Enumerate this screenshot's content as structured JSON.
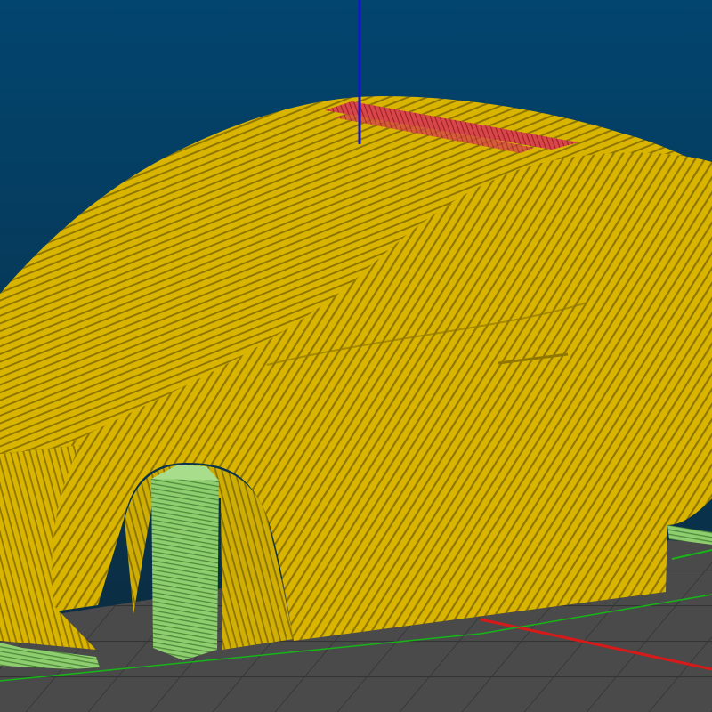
{
  "viewport": {
    "background_top": "#02456f",
    "background_bottom": "#0c2a3c",
    "bed_color": "#4a4a4a",
    "bed_grid_color": "#333333"
  },
  "colors": {
    "external_perimeter": "#d9b400",
    "perimeter_shadow": "#8f7600",
    "top_solid_infill": "#d9464a",
    "support_material": "#8fce6f",
    "support_shadow": "#4f8a3a",
    "axis_x": "#d61a1a",
    "axis_y": "#17b517",
    "axis_z": "#1515d6"
  }
}
